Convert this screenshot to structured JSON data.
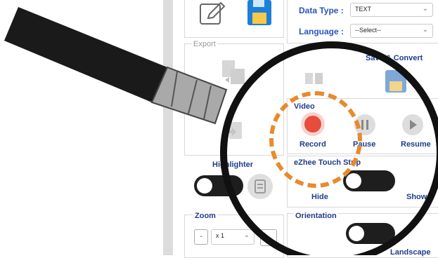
{
  "form": {
    "data_type_label": "Data Type :",
    "data_type_value": "TEXT",
    "language_label": "Language :",
    "language_value": "--Select--"
  },
  "export": {
    "title": "Export"
  },
  "save_convert": {
    "label": "Save & Convert"
  },
  "video": {
    "title": "Video",
    "record_label": "Record",
    "pause_label": "Pause",
    "resume_label": "Resume",
    "record_color": "#e74c3c"
  },
  "highlighter": {
    "label": "Highlighter"
  },
  "touch_strip": {
    "title": "eZhee Touch Strip",
    "hide_label": "Hide",
    "show_label": "Show"
  },
  "zoom": {
    "title": "Zoom",
    "minus_label": "-",
    "value": "x 1"
  },
  "orientation": {
    "title": "Orientation",
    "landscape_label": "Landscape"
  },
  "accent": {
    "dashed_circle": "#e88a2d",
    "handle": "#1a1a1a"
  }
}
